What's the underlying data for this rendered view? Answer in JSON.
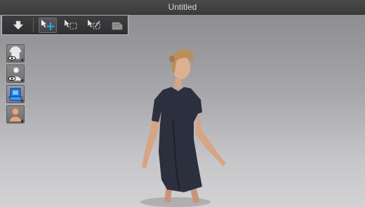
{
  "window": {
    "title": "Untitled"
  },
  "toolbar": {
    "buttons": [
      {
        "icon": "down-arrow-icon",
        "active": false
      },
      {
        "icon": "select-move-icon",
        "active": true
      },
      {
        "icon": "rect-select-icon",
        "active": false
      },
      {
        "icon": "resize-select-icon",
        "active": false
      },
      {
        "icon": "camera-icon",
        "active": false
      }
    ]
  },
  "left_tools": [
    {
      "icon": "show-garment-icon"
    },
    {
      "icon": "show-avatar-icon"
    },
    {
      "icon": "texture-view-icon"
    },
    {
      "icon": "avatar-skin-icon"
    }
  ],
  "colors": {
    "accent": "#2aa8e0",
    "dress": "#2c2f3e",
    "skin": "#d8a888",
    "hair": "#b89060"
  }
}
